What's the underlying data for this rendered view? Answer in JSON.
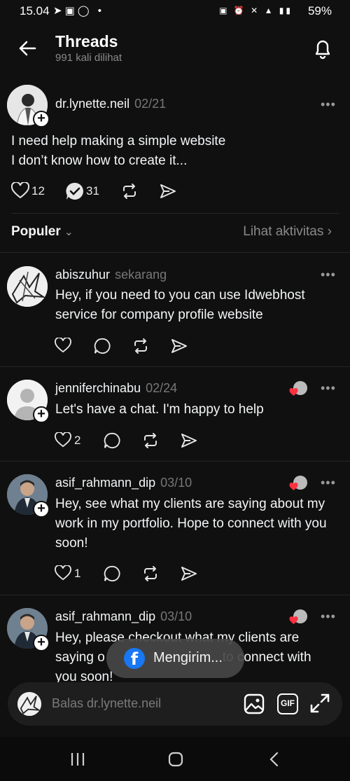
{
  "status_bar": {
    "time": "15.04",
    "battery": "59%"
  },
  "header": {
    "title": "Threads",
    "subtitle": "991 kali dilihat"
  },
  "original_post": {
    "username": "dr.lynette.neil",
    "timestamp": "02/21",
    "text_line1": "I need help making a simple website",
    "text_line2": "I don’t know how to create it...",
    "likes": "12",
    "replies": "31"
  },
  "sort": {
    "label": "Populer",
    "activity_link": "Lihat aktivitas"
  },
  "replies": [
    {
      "username": "abiszuhur",
      "timestamp": "sekarang",
      "text_line1": "Hey, if you need to you can use Idwebhost",
      "text_line2": "service for company profile website",
      "likes": ""
    },
    {
      "username": "jenniferchinabu",
      "timestamp": "02/24",
      "text_line1": "Let's have a chat. I'm happy to help",
      "likes": "2"
    },
    {
      "username": "asif_rahmann_dip",
      "timestamp": "03/10",
      "text_line1": "Hey, see what my clients are saying about my",
      "text_line2": "work in my portfolio. Hope to connect with you",
      "text_line3": "soon!",
      "likes": "1"
    },
    {
      "username": "asif_rahmann_dip",
      "timestamp": "03/10",
      "text_line1": "Hey, please checkout what my clients are",
      "text_line2_left": "saying o",
      "text_line2_right": "to connect with",
      "text_line3": "you soon!"
    }
  ],
  "toast": {
    "text": "Mengirim..."
  },
  "reply_bar": {
    "placeholder": "Balas dr.lynette.neil",
    "gif_label": "GIF"
  }
}
